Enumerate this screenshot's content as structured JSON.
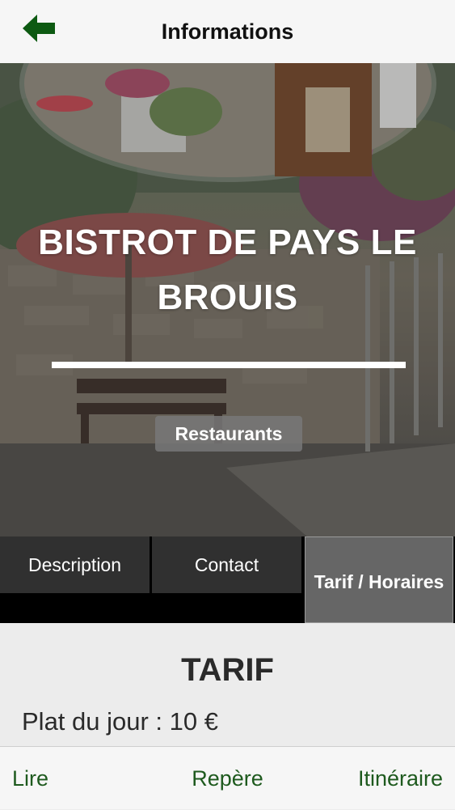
{
  "navbar": {
    "title": "Informations",
    "back_icon": "back-arrow-icon",
    "accent_color": "#0d5a12"
  },
  "hero": {
    "title": "BISTROT DE PAYS LE BROUIS",
    "category": "Restaurants"
  },
  "tabs": [
    {
      "label": "Description",
      "active": false
    },
    {
      "label": "Contact",
      "active": false
    },
    {
      "label": "Tarif / Horaires",
      "active": true
    }
  ],
  "content": {
    "section_title": "TARIF",
    "lines": [
      "Plat du jour : 10 €"
    ]
  },
  "bottombar": {
    "items": [
      {
        "label": "Lire"
      },
      {
        "label": "Repère"
      },
      {
        "label": "Itinéraire"
      }
    ],
    "link_color": "#1e5a1e"
  }
}
